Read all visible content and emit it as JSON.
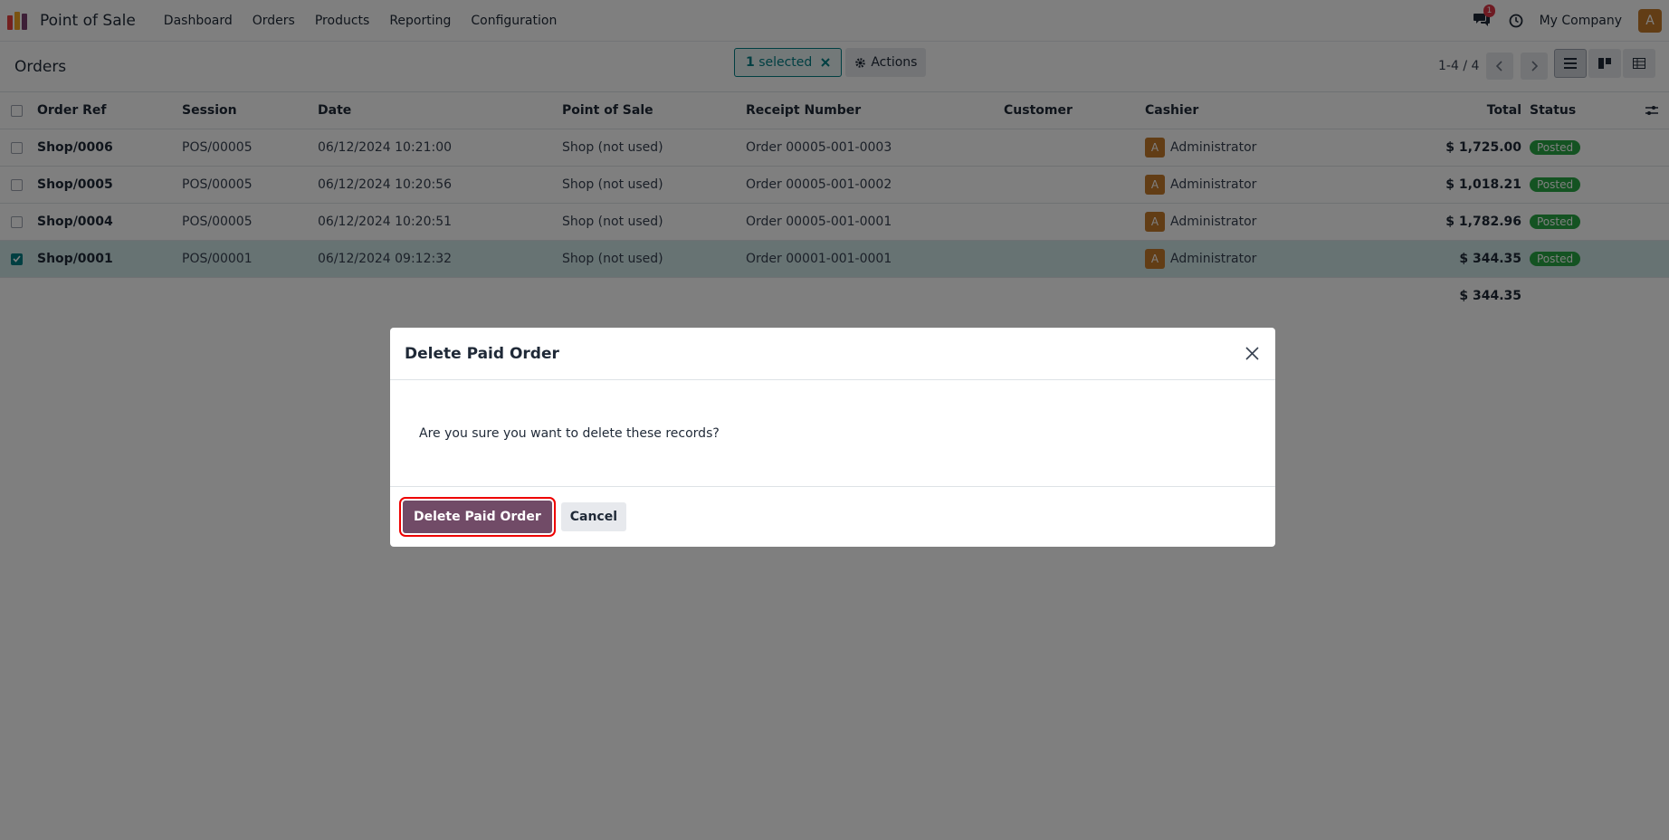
{
  "app": {
    "title": "Point of Sale",
    "logo_colors": [
      "#e6413f",
      "#f5a623",
      "#4a7bd0",
      "#7b3f6e"
    ],
    "menu": [
      "Dashboard",
      "Orders",
      "Products",
      "Reporting",
      "Configuration"
    ],
    "notification_count": "1",
    "company": "My Company",
    "user_initial": "A"
  },
  "control": {
    "breadcrumb": "Orders",
    "selected_count": "1",
    "selected_label": "selected",
    "actions_label": "Actions",
    "pager": "1-4 / 4"
  },
  "table": {
    "headers": {
      "order_ref": "Order Ref",
      "session": "Session",
      "date": "Date",
      "pos": "Point of Sale",
      "receipt": "Receipt Number",
      "customer": "Customer",
      "cashier": "Cashier",
      "total": "Total",
      "status": "Status"
    },
    "rows": [
      {
        "order_ref": "Shop/0006",
        "session": "POS/00005",
        "date": "06/12/2024 10:21:00",
        "pos": "Shop (not used)",
        "receipt": "Order 00005-001-0003",
        "customer": "",
        "cashier_initial": "A",
        "cashier": "Administrator",
        "total": "$ 1,725.00",
        "status": "Posted",
        "selected": false
      },
      {
        "order_ref": "Shop/0005",
        "session": "POS/00005",
        "date": "06/12/2024 10:20:56",
        "pos": "Shop (not used)",
        "receipt": "Order 00005-001-0002",
        "customer": "",
        "cashier_initial": "A",
        "cashier": "Administrator",
        "total": "$ 1,018.21",
        "status": "Posted",
        "selected": false
      },
      {
        "order_ref": "Shop/0004",
        "session": "POS/00005",
        "date": "06/12/2024 10:20:51",
        "pos": "Shop (not used)",
        "receipt": "Order 00005-001-0001",
        "customer": "",
        "cashier_initial": "A",
        "cashier": "Administrator",
        "total": "$ 1,782.96",
        "status": "Posted",
        "selected": false
      },
      {
        "order_ref": "Shop/0001",
        "session": "POS/00001",
        "date": "06/12/2024 09:12:32",
        "pos": "Shop (not used)",
        "receipt": "Order 00001-001-0001",
        "customer": "",
        "cashier_initial": "A",
        "cashier": "Administrator",
        "total": "$ 344.35",
        "status": "Posted",
        "selected": true
      }
    ],
    "sum_total": "$ 344.35"
  },
  "dialog": {
    "title": "Delete Paid Order",
    "message": "Are you sure you want to delete these records?",
    "confirm_label": "Delete Paid Order",
    "cancel_label": "Cancel"
  }
}
